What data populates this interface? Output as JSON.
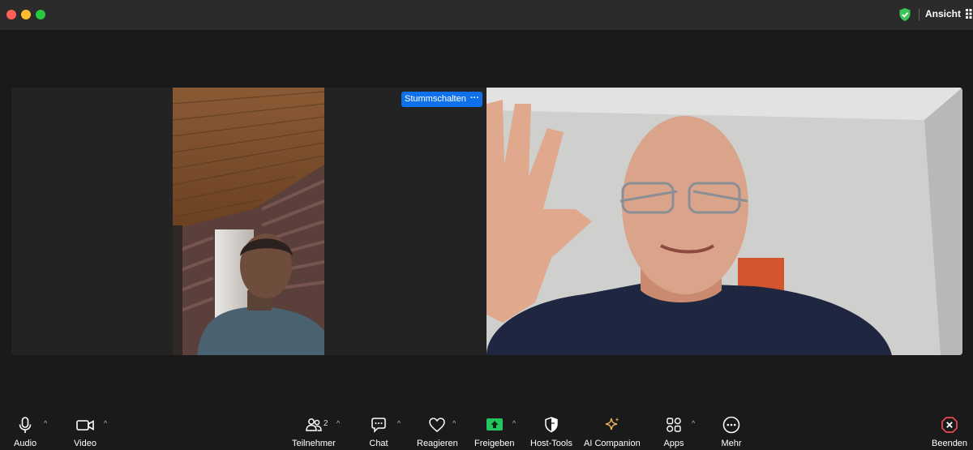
{
  "titlebar": {
    "view_label": "Ansicht",
    "shield_color": "#3ec45a"
  },
  "stage": {
    "mute_label": "Stummschalten",
    "more_label": "···"
  },
  "toolbar": {
    "audio": "Audio",
    "video": "Video",
    "participants": "Teilnehmer",
    "participants_count": "2",
    "chat": "Chat",
    "react": "Reagieren",
    "share": "Freigeben",
    "host_tools": "Host-Tools",
    "ai_companion": "AI Companion",
    "apps": "Apps",
    "more": "Mehr",
    "end": "Beenden",
    "share_color": "#22c55e",
    "end_color": "#e5484d",
    "ai_color": "#e6b35a"
  }
}
